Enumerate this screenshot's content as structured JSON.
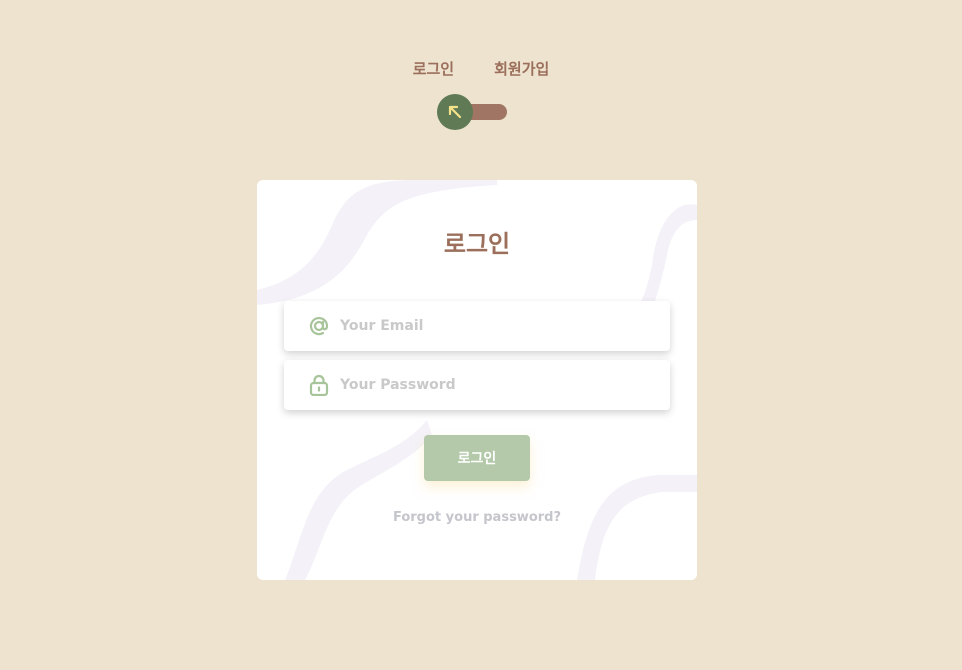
{
  "toggle": {
    "login_label": "로그인",
    "signup_label": "회원가입"
  },
  "card": {
    "title": "로그인",
    "email_placeholder": "Your Email",
    "password_placeholder": "Your Password",
    "submit_label": "로그인",
    "forgot_link": "Forgot your password?"
  },
  "colors": {
    "background": "#ede3cf",
    "accent_brown": "#9b6f5b",
    "knob_green": "#5f7a55",
    "button_green": "#b3c9a9",
    "icon_green": "#a8c49b"
  },
  "icons": {
    "toggle_knob": "arrow-up-left-icon",
    "email": "at-sign-icon",
    "password": "lock-icon"
  }
}
